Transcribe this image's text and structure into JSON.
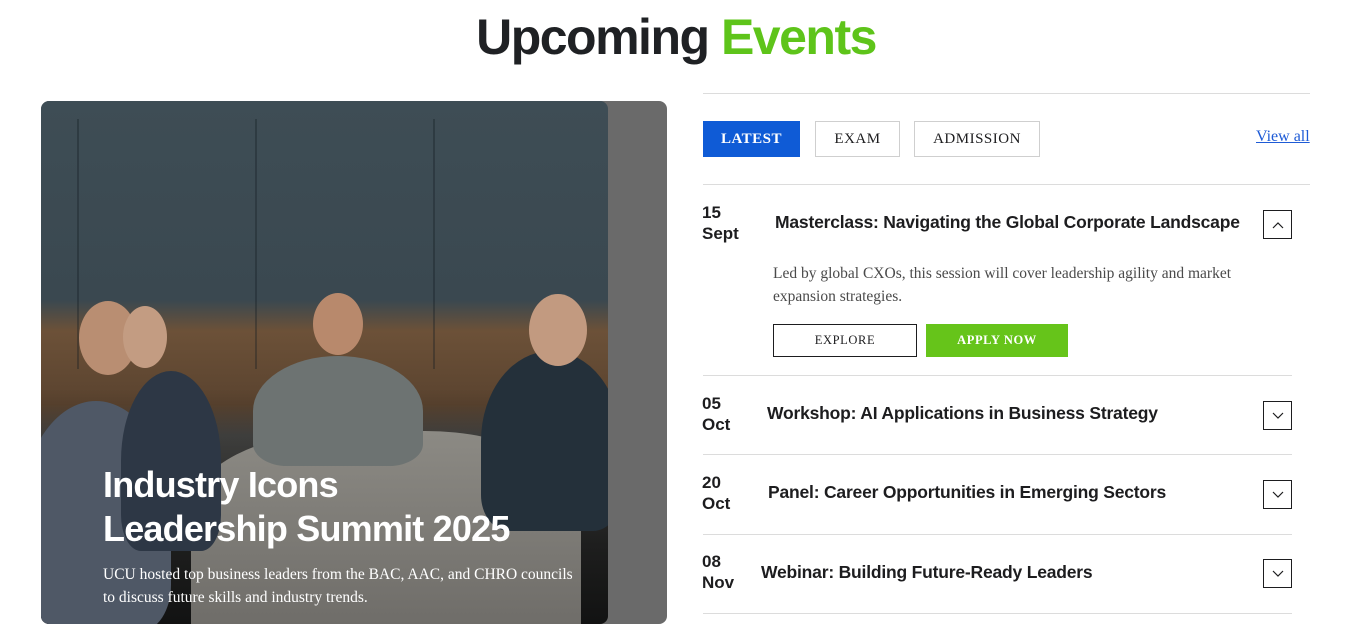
{
  "section": {
    "title_main": "Upcoming",
    "title_accent": "Events"
  },
  "colors": {
    "accent_green": "#5ec41a",
    "tab_active_blue": "#0f5bd6",
    "link_blue": "#1e5bd6",
    "apply_button_green": "#66c41a"
  },
  "hero": {
    "title_line1": "Industry Icons",
    "title_line2": "Leadership Summit 2025",
    "description": "UCU hosted top business leaders from the BAC, AAC, and CHRO councils to discuss future skills and industry trends."
  },
  "tabs": [
    {
      "label": "LATEST",
      "active": true
    },
    {
      "label": "EXAM",
      "active": false
    },
    {
      "label": "ADMISSION",
      "active": false
    }
  ],
  "view_all_label": "View all",
  "events": [
    {
      "day": "15",
      "month": "Sept",
      "title": "Masterclass: Navigating the Global Corporate Landscape",
      "expanded": true,
      "toggle_icon": "chevron-up-icon",
      "description": "Led by global CXOs, this session will cover leadership agility and market expansion strategies.",
      "explore_label": "EXPLORE",
      "apply_label": "APPLY NOW"
    },
    {
      "day": "05",
      "month": "Oct",
      "title": "Workshop: AI Applications in Business Strategy",
      "expanded": false,
      "toggle_icon": "chevron-down-icon"
    },
    {
      "day": "20",
      "month": "Oct",
      "title": "Panel: Career Opportunities in Emerging Sectors",
      "expanded": false,
      "toggle_icon": "chevron-down-icon"
    },
    {
      "day": "08",
      "month": "Nov",
      "title": "Webinar: Building Future-Ready Leaders",
      "expanded": false,
      "toggle_icon": "chevron-down-icon"
    }
  ]
}
